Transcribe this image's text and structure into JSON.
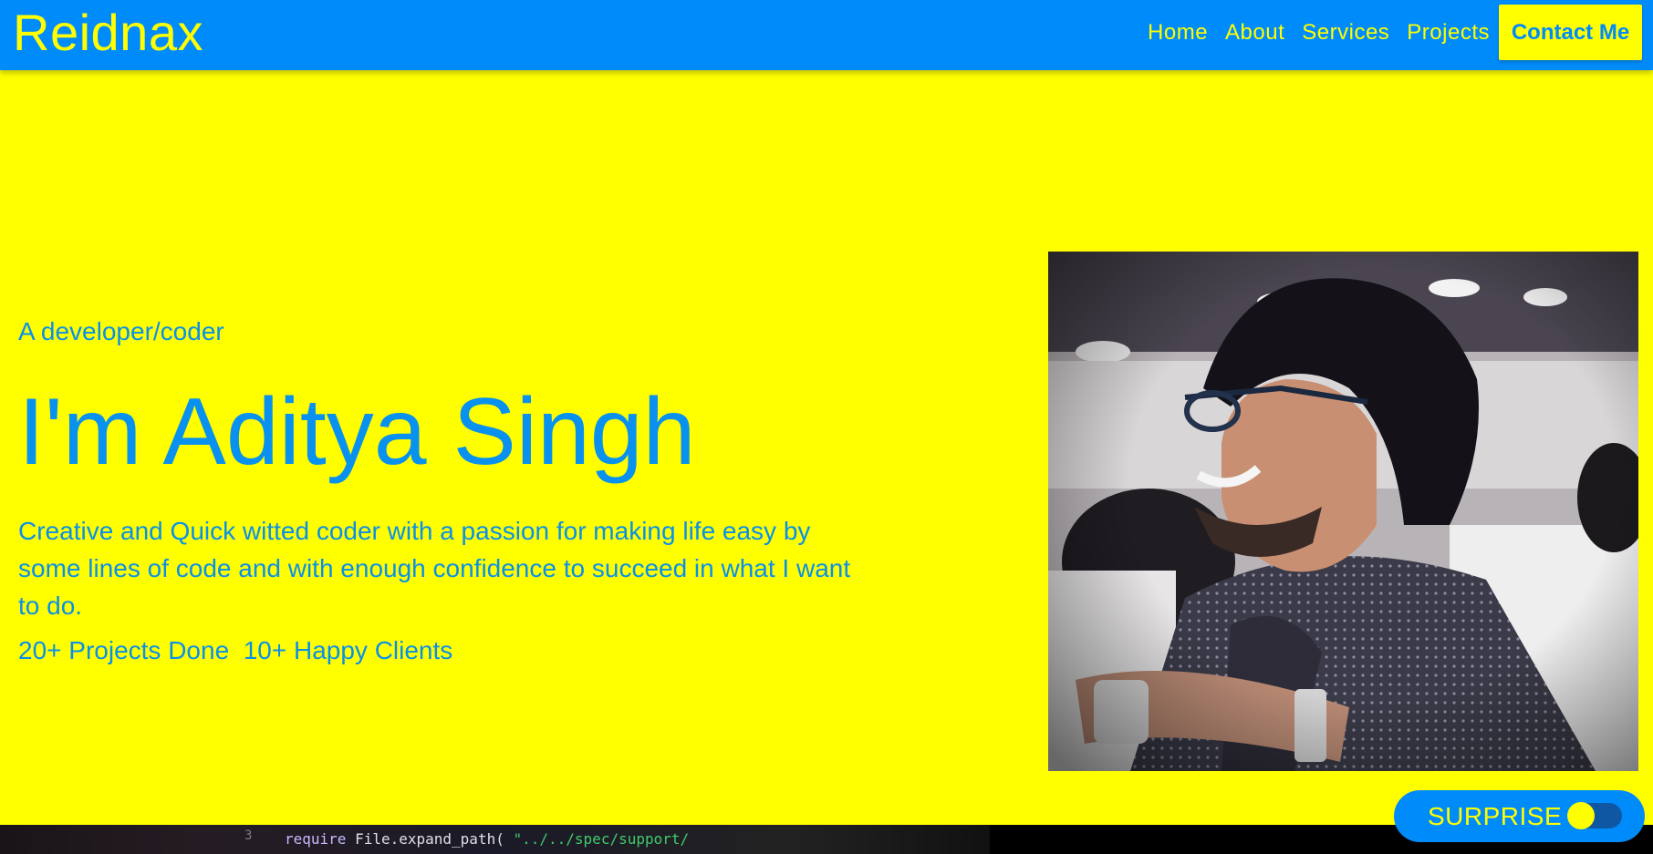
{
  "brand": "Reidnax",
  "nav": {
    "links": [
      "Home",
      "About",
      "Services",
      "Projects"
    ],
    "contact_label": "Contact Me"
  },
  "hero": {
    "subtitle": "A developer/coder",
    "name": "I'm Aditya Singh",
    "bio": "Creative and Quick witted coder with a passion for making life easy by some lines of code and with enough confidence to succeed in what I want to do.",
    "stats": "20+ Projects Done  10+ Happy Clients"
  },
  "portrait": {
    "icon": "profile-photo"
  },
  "bottom": {
    "line_number": "3",
    "code_keyword": "require",
    "code_text": "File.expand_path(",
    "code_string": "\"../../spec/support/"
  },
  "surprise": {
    "label": "SURPRISE",
    "toggle_on": false
  },
  "colors": {
    "navbar": "#008bfb",
    "accent": "#ffff00",
    "text_blue": "#0a90e8"
  }
}
